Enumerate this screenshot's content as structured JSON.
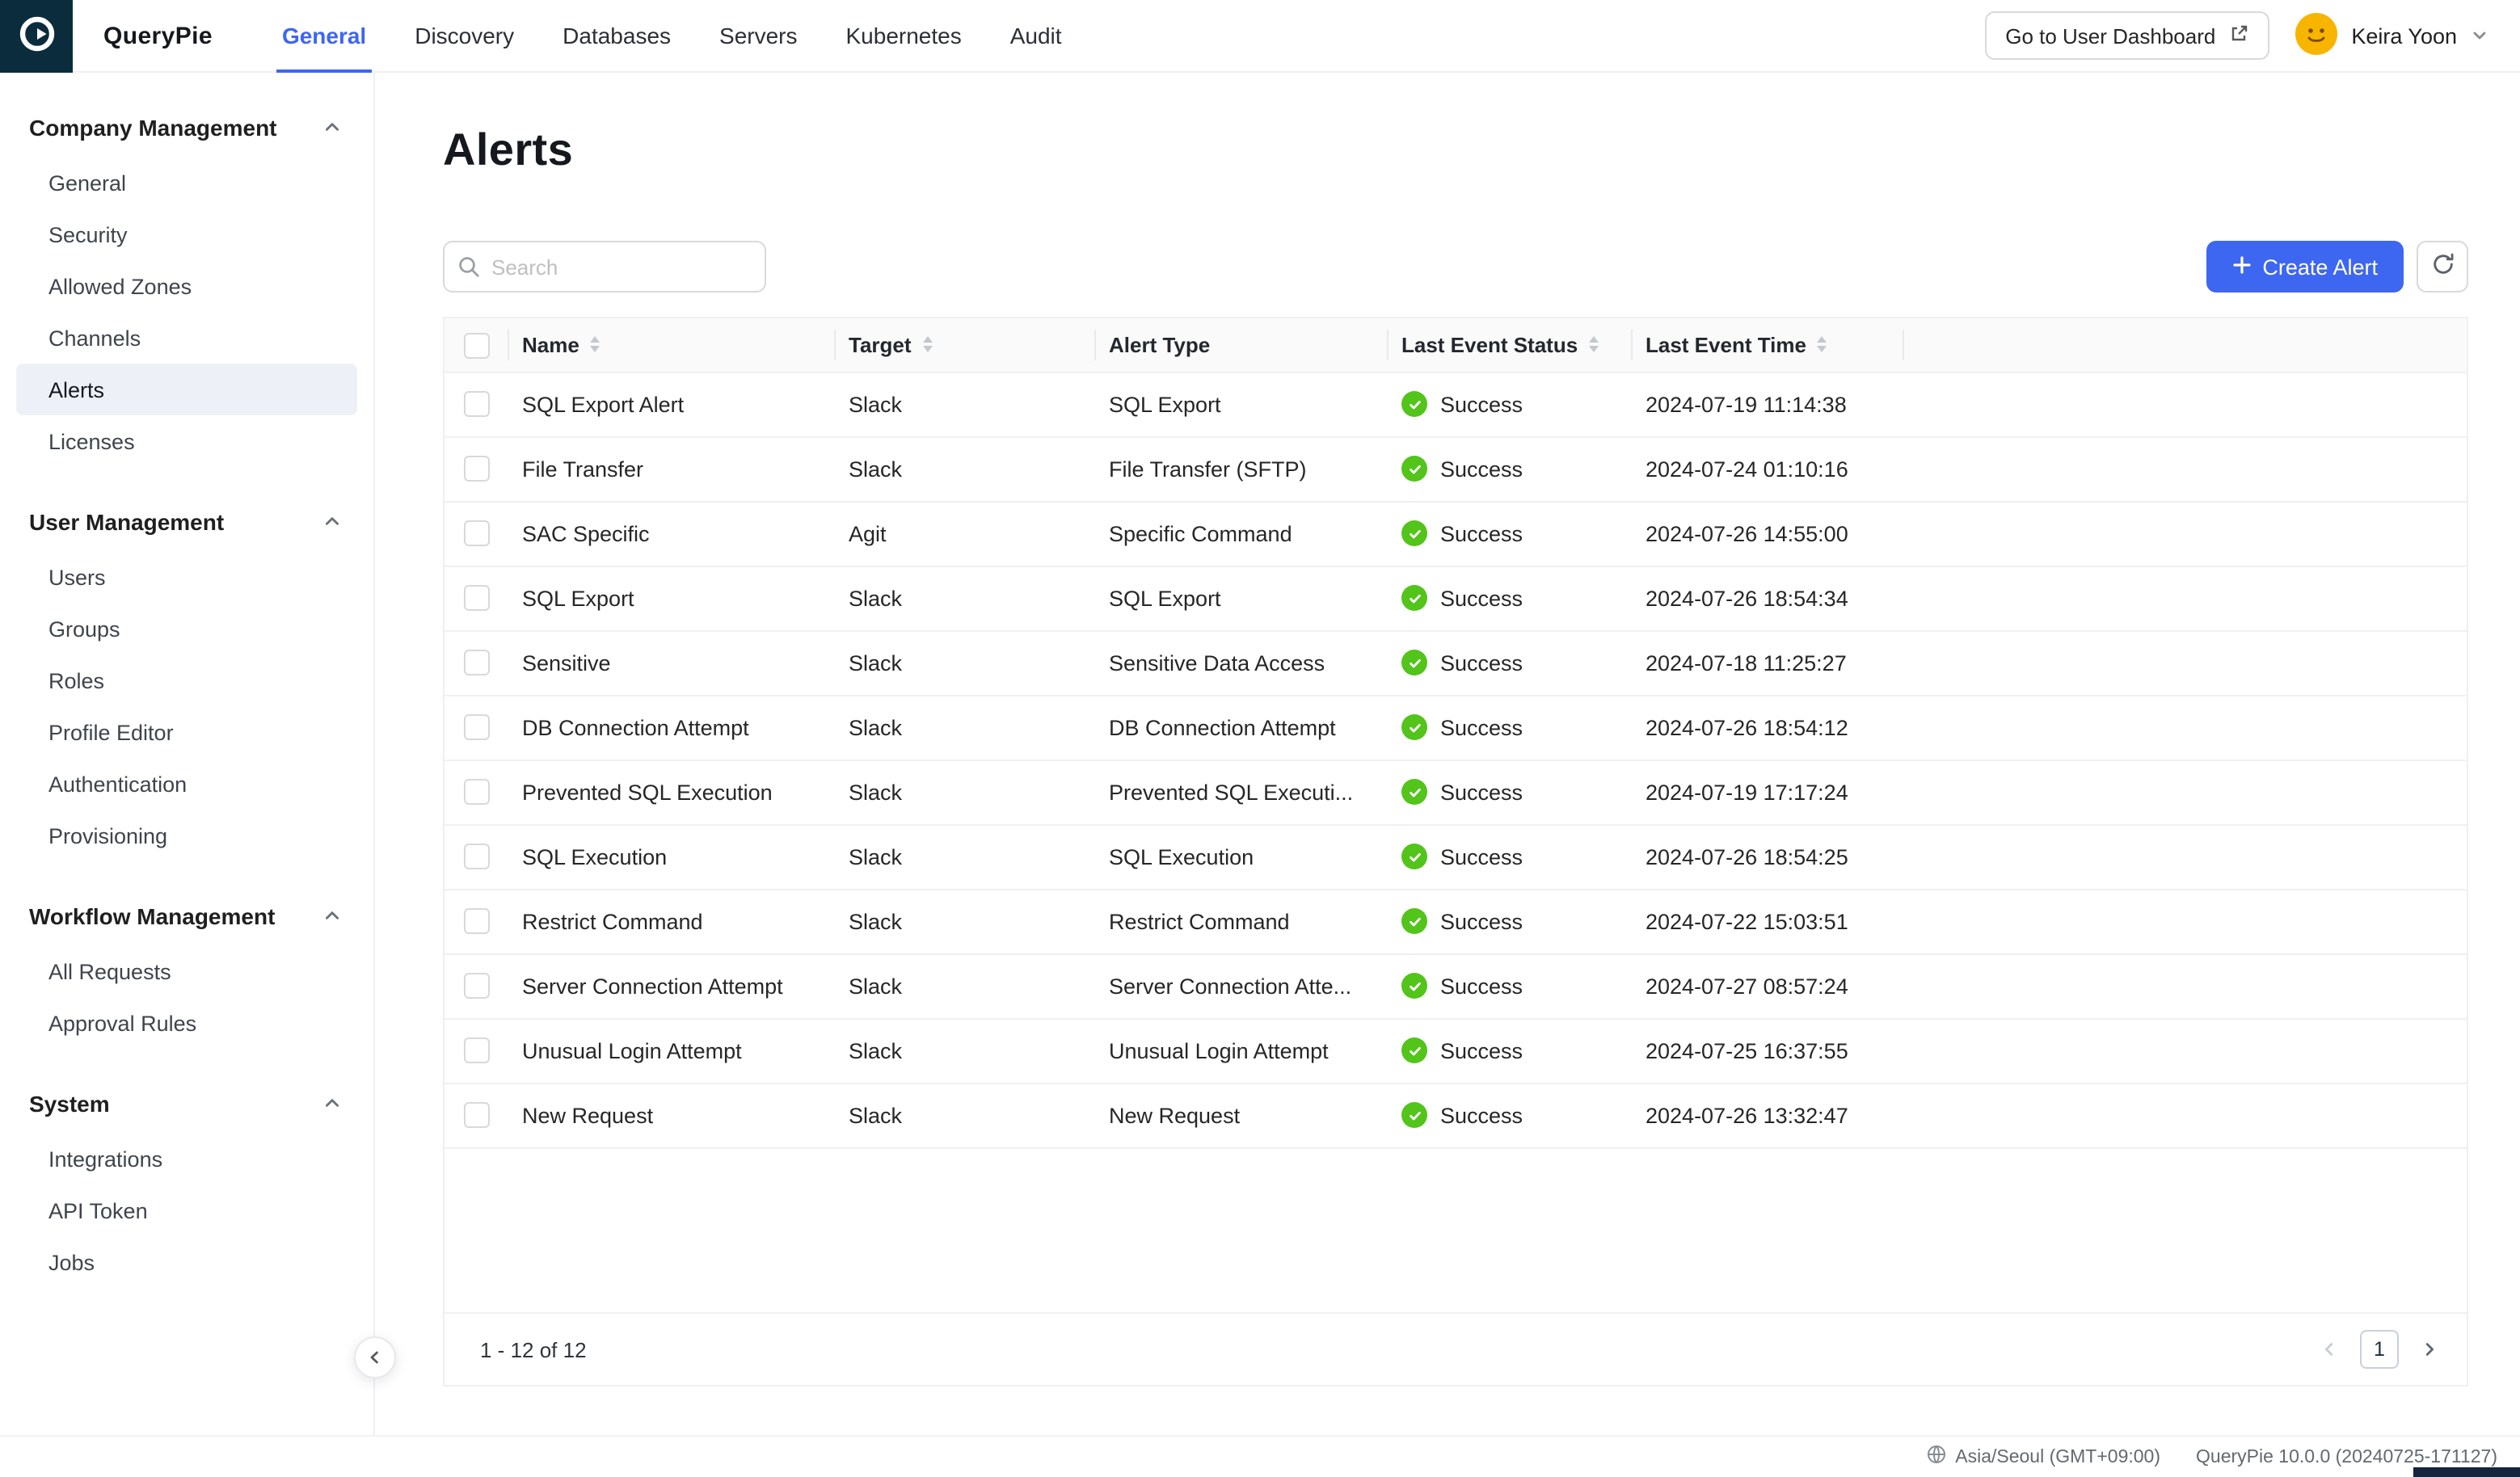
{
  "colors": {
    "accent": "#3D66F1",
    "success": "#52C41A",
    "logo_bg": "#0B2C3D",
    "avatar_bg": "#F7B500",
    "active_item_bg": "#EDF1F7"
  },
  "topbar": {
    "brand": "QueryPie",
    "nav": [
      {
        "label": "General",
        "active": true
      },
      {
        "label": "Discovery",
        "active": false
      },
      {
        "label": "Databases",
        "active": false
      },
      {
        "label": "Servers",
        "active": false
      },
      {
        "label": "Kubernetes",
        "active": false
      },
      {
        "label": "Audit",
        "active": false
      }
    ],
    "dashboard_button": "Go to User Dashboard",
    "user_name": "Keira Yoon"
  },
  "sidebar": {
    "sections": [
      {
        "title": "Company Management",
        "items": [
          {
            "label": "General",
            "active": false
          },
          {
            "label": "Security",
            "active": false
          },
          {
            "label": "Allowed Zones",
            "active": false
          },
          {
            "label": "Channels",
            "active": false
          },
          {
            "label": "Alerts",
            "active": true
          },
          {
            "label": "Licenses",
            "active": false
          }
        ]
      },
      {
        "title": "User Management",
        "items": [
          {
            "label": "Users",
            "active": false
          },
          {
            "label": "Groups",
            "active": false
          },
          {
            "label": "Roles",
            "active": false
          },
          {
            "label": "Profile Editor",
            "active": false
          },
          {
            "label": "Authentication",
            "active": false
          },
          {
            "label": "Provisioning",
            "active": false
          }
        ]
      },
      {
        "title": "Workflow Management",
        "items": [
          {
            "label": "All Requests",
            "active": false
          },
          {
            "label": "Approval Rules",
            "active": false
          }
        ]
      },
      {
        "title": "System",
        "items": [
          {
            "label": "Integrations",
            "active": false
          },
          {
            "label": "API Token",
            "active": false
          },
          {
            "label": "Jobs",
            "active": false
          }
        ]
      }
    ]
  },
  "main": {
    "title": "Alerts",
    "search_placeholder": "Search",
    "create_button": "Create Alert",
    "table": {
      "columns": [
        {
          "label": "Name",
          "sortable": true
        },
        {
          "label": "Target",
          "sortable": true
        },
        {
          "label": "Alert Type",
          "sortable": false
        },
        {
          "label": "Last Event Status",
          "sortable": true
        },
        {
          "label": "Last Event Time",
          "sortable": true
        }
      ],
      "rows": [
        {
          "name": "SQL Export Alert",
          "target": "Slack",
          "alert_type": "SQL Export",
          "status": "Success",
          "time": "2024-07-19 11:14:38"
        },
        {
          "name": "File Transfer",
          "target": "Slack",
          "alert_type": "File Transfer (SFTP)",
          "status": "Success",
          "time": "2024-07-24 01:10:16"
        },
        {
          "name": "SAC Specific",
          "target": "Agit",
          "alert_type": "Specific Command",
          "status": "Success",
          "time": "2024-07-26 14:55:00"
        },
        {
          "name": "SQL Export",
          "target": "Slack",
          "alert_type": "SQL Export",
          "status": "Success",
          "time": "2024-07-26 18:54:34"
        },
        {
          "name": "Sensitive",
          "target": "Slack",
          "alert_type": "Sensitive Data Access",
          "status": "Success",
          "time": "2024-07-18 11:25:27"
        },
        {
          "name": "DB Connection Attempt",
          "target": "Slack",
          "alert_type": "DB Connection Attempt",
          "status": "Success",
          "time": "2024-07-26 18:54:12"
        },
        {
          "name": "Prevented SQL Execution",
          "target": "Slack",
          "alert_type": "Prevented SQL Executi...",
          "status": "Success",
          "time": "2024-07-19 17:17:24"
        },
        {
          "name": "SQL Execution",
          "target": "Slack",
          "alert_type": "SQL Execution",
          "status": "Success",
          "time": "2024-07-26 18:54:25"
        },
        {
          "name": "Restrict Command",
          "target": "Slack",
          "alert_type": "Restrict Command",
          "status": "Success",
          "time": "2024-07-22 15:03:51"
        },
        {
          "name": "Server Connection Attempt",
          "target": "Slack",
          "alert_type": "Server Connection Atte...",
          "status": "Success",
          "time": "2024-07-27 08:57:24"
        },
        {
          "name": "Unusual Login Attempt",
          "target": "Slack",
          "alert_type": "Unusual Login Attempt",
          "status": "Success",
          "time": "2024-07-25 16:37:55"
        },
        {
          "name": "New Request",
          "target": "Slack",
          "alert_type": "New Request",
          "status": "Success",
          "time": "2024-07-26 13:32:47"
        }
      ],
      "summary": "1 - 12 of 12",
      "pagination": {
        "current": "1"
      }
    }
  },
  "statusbar": {
    "timezone": "Asia/Seoul (GMT+09:00)",
    "version": "QueryPie 10.0.0 (20240725-171127)"
  }
}
